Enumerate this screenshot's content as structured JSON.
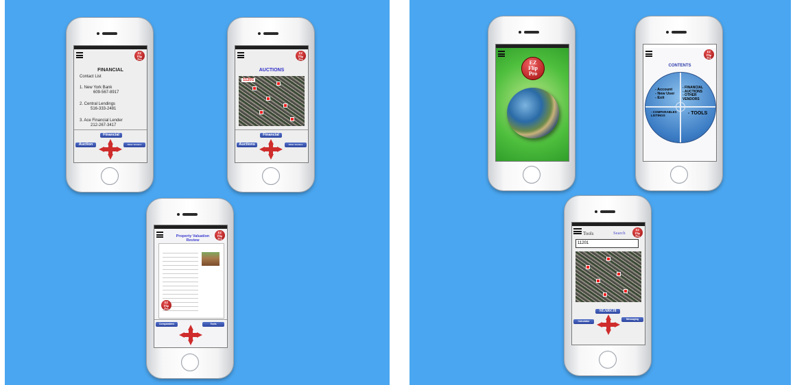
{
  "background_color": "#4aa6f0",
  "logo": {
    "line1": "EZ",
    "line2": "Flip",
    "line3": "Pro"
  },
  "financial": {
    "title": "FINANCIAL",
    "subtitle": "Contact List",
    "contacts": [
      {
        "name": "1. New York Bank",
        "phone": "609-567-8917"
      },
      {
        "name": "2. Central Lendings",
        "phone": "516-333-2481"
      },
      {
        "name": "3. Ace Financial Lender",
        "phone": "212-267-3417"
      }
    ],
    "nav_top": "Financial",
    "nav_left": "Auction",
    "nav_right": "Other Vendors"
  },
  "auctions": {
    "title": "AUCTIONS",
    "zip_label": "11201",
    "nav_top": "Financial",
    "nav_left": "Auctions",
    "nav_right": "Other Vendors"
  },
  "valuation": {
    "title": "Property Valuation Review",
    "nav_left": "Comparables",
    "nav_right": "Tools"
  },
  "splash": {
    "logo_line1": "EZ",
    "logo_line2": "Flip",
    "logo_line3": "Pro"
  },
  "contents": {
    "title": "CONTENTS",
    "q1": [
      "- Account",
      "- New User",
      "- Exit"
    ],
    "q2": [
      "- FINANCIAL",
      "- AUCTIONS",
      "- OTHER",
      "VENDORS"
    ],
    "q3": [
      "- COMPARABLES",
      "LISTINGS"
    ],
    "q4": "- TOOLS"
  },
  "tools": {
    "title": "Tools",
    "search_link": "Search",
    "input_value": "11201",
    "search_button": "SEARCH",
    "nav_left": "Calculator",
    "nav_right": "Messaging"
  }
}
